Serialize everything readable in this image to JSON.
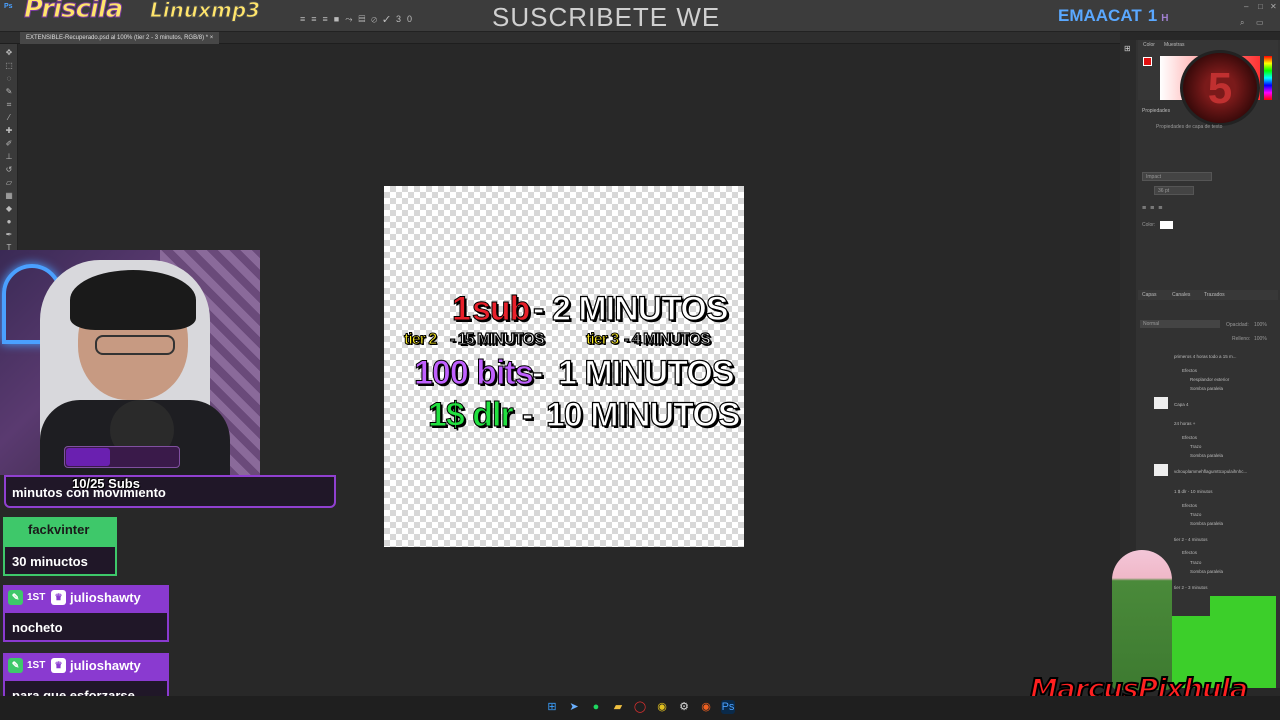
{
  "app": {
    "title": "Ps",
    "document_tab": "EXTENSIBLE-Recuperado.psd al 100% (tier 2 - 3 minutos, RGB/8) *"
  },
  "overlays": {
    "left_logo": "Priscila",
    "left_logo2": "Linuxmp3",
    "center_banner": "SUSCRIBETE WE",
    "right_brand": "EMAACAT",
    "right_brand_num": "1",
    "right_brand_h": "H",
    "bottom_right_watermark": "MarcusPixhula"
  },
  "options_bar": {
    "zoom_value": "30"
  },
  "canvas": {
    "line1_num": "1",
    "line1_word": "sub",
    "line1_dash": "-",
    "line1_rest": "2 MINUTOS",
    "line2a_tier": "tier 2",
    "line2a_rest": "- 15 MINUTOS",
    "line2b_tier": "tier 3",
    "line2b_rest": "- 4 MINUTOS",
    "line3_bits": "100 bits",
    "line3_dash": "-",
    "line3_rest": "1 MINUTOS",
    "line4_money": "1$ dlr",
    "line4_dash": "-",
    "line4_rest": "10 MINUTOS"
  },
  "right_panel": {
    "color_tab": "Color",
    "swatches_tab": "Muestras",
    "properties_tab": "Propiedades",
    "properties_sub": "Propiedades de capa de texto",
    "font_name": "Impact",
    "font_size": "36 pt",
    "color_label": "Color:",
    "layers_tabs": [
      "Capas",
      "Canales",
      "Trazados"
    ],
    "blend_mode": "Normal",
    "opacity_label": "Opacidad:",
    "opacity_value": "100%",
    "fill_label": "Relleno:",
    "fill_value": "100%",
    "badge_number": "5",
    "layers": [
      "primeros 4 horas todo a 15 m...",
      "Efectos",
      "Resplandor exterior",
      "Sombra paralela",
      "Capa 4",
      "24 horas +",
      "Efectos",
      "Trazo",
      "Sombra paralela",
      "vdrouplammehflagumttcxpulaihnhc...",
      "1 $ dlr - 10 minutos",
      "Efectos",
      "Trazo",
      "Sombra paralela",
      "tier 2 - 4 minutos",
      "Efectos",
      "Trazo",
      "Sombra paralela",
      "tier 2 - 3 minutos"
    ]
  },
  "stream": {
    "subs_goal": "10/25 Subs",
    "chat": [
      {
        "user": "",
        "message": "minutos con movimiento"
      },
      {
        "user": "fackvinter",
        "message": "30 minuctos"
      },
      {
        "user": "julioshawty",
        "message": "nocheto",
        "badge": "1ST"
      },
      {
        "user": "julioshawty",
        "message": "para que esforzarse",
        "badge": "1ST"
      }
    ]
  },
  "colors": {
    "ps_bg": "#282828",
    "accent_green": "#3ec86a",
    "accent_purple": "#8a3ad0"
  }
}
